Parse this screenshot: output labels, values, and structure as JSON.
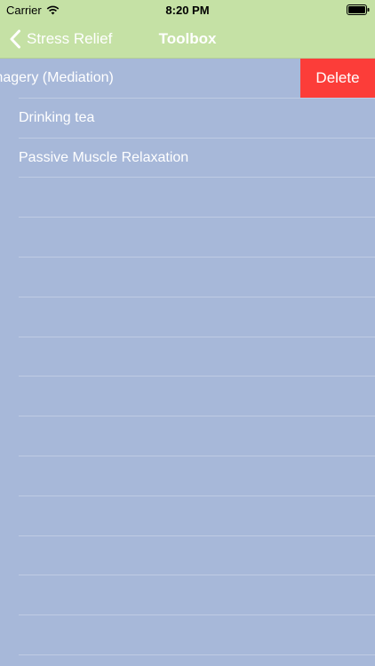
{
  "status_bar": {
    "carrier": "Carrier",
    "time": "8:20 PM",
    "wifi_icon": "wifi-icon",
    "battery_icon": "battery-icon"
  },
  "nav_bar": {
    "back_label": "Stress Relief",
    "back_icon": "chevron-left-icon",
    "title": "Toolbox",
    "background_color": "#c5e1a5"
  },
  "list": {
    "background_color": "#a7b8d9",
    "items": [
      {
        "label": "magery (Mediation)",
        "swiped": true,
        "action_label": "Delete"
      },
      {
        "label": "Drinking tea"
      },
      {
        "label": "Passive Muscle Relaxation"
      }
    ],
    "empty_rows": 12
  },
  "colors": {
    "delete": "#fc3d39",
    "text": "#ffffff"
  }
}
